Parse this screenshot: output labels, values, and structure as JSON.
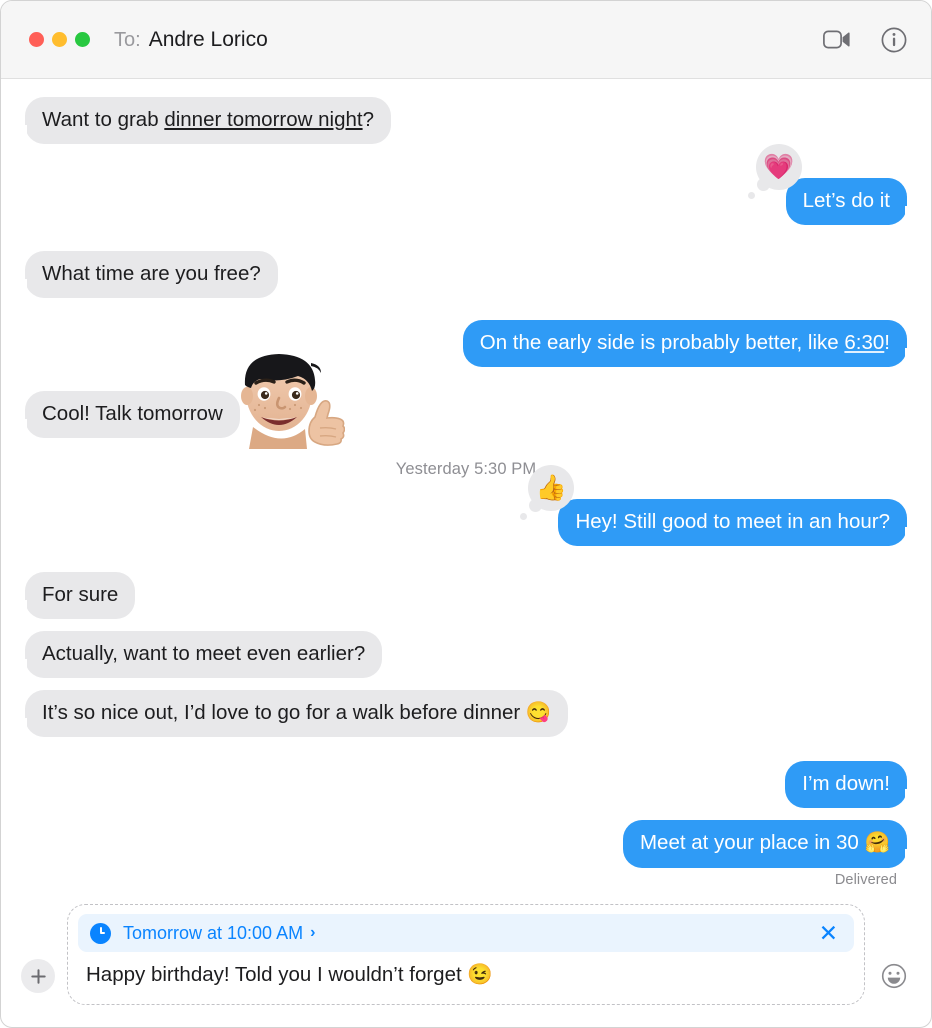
{
  "window": {
    "traffic_lights": [
      {
        "name": "close",
        "color": "#ff5f57"
      },
      {
        "name": "minimize",
        "color": "#ffbd2e"
      },
      {
        "name": "maximize",
        "color": "#28c840"
      }
    ]
  },
  "titlebar": {
    "to_label": "To:",
    "recipient": "Andre Lorico",
    "facetime_icon": "video-camera-icon",
    "info_icon": "info-circle-icon"
  },
  "colors": {
    "outgoing_bubble": "#2f9bf6",
    "incoming_bubble": "#e8e8ea",
    "accent_blue": "#0a84ff",
    "schedule_banner_bg": "#eaf4fe",
    "titlebar_bg": "#f6f6f6"
  },
  "conversation": {
    "messages": [
      {
        "id": "m1",
        "direction": "in",
        "text_before": "Want to grab ",
        "link": "dinner tomorrow night",
        "text_after": "?",
        "tapback": null
      },
      {
        "id": "m2",
        "direction": "out",
        "text_before": "Let’s do it",
        "link": "",
        "text_after": "",
        "tapback": "💗",
        "tapback_name": "heart-tapback"
      },
      {
        "id": "m3",
        "direction": "in",
        "text_before": "What time are you free?",
        "link": "",
        "text_after": "",
        "tapback": null
      },
      {
        "id": "m4",
        "direction": "out",
        "text_before": "On the early side is probably better, like ",
        "link": "6:30",
        "text_after": "!",
        "tapback": null
      },
      {
        "id": "m5",
        "direction": "in",
        "text_before": "Cool! Talk tomorrow",
        "link": "",
        "text_after": "",
        "tapback": null,
        "sticker": "memoji-thumbs-up-sticker"
      }
    ],
    "timestamp": "Yesterday 5:30 PM",
    "messages_after": [
      {
        "id": "m6",
        "direction": "out",
        "text_before": "Hey! Still good to meet in an hour?",
        "link": "",
        "text_after": "",
        "tapback": "👍",
        "tapback_name": "thumbs-up-tapback"
      },
      {
        "id": "m7",
        "direction": "in",
        "text_before": "For sure",
        "link": "",
        "text_after": "",
        "tapback": null
      },
      {
        "id": "m8",
        "direction": "in",
        "text_before": "Actually, want to meet even earlier?",
        "link": "",
        "text_after": "",
        "tapback": null
      },
      {
        "id": "m9",
        "direction": "in",
        "text_before": "It’s so nice out, I’d love to go for a walk before dinner 😋",
        "link": "",
        "text_after": "",
        "tapback": null
      },
      {
        "id": "m10",
        "direction": "out",
        "text_before": "I’m down!",
        "link": "",
        "text_after": "",
        "tapback": null
      },
      {
        "id": "m11",
        "direction": "out",
        "text_before": "Meet at your place in 30 🤗",
        "link": "",
        "text_after": "",
        "tapback": null
      }
    ],
    "delivered_label": "Delivered"
  },
  "composer": {
    "add_button_label": "+",
    "add_button_icon": "plus-icon",
    "emoji_button_icon": "smiley-face-icon",
    "schedule": {
      "icon": "clock-icon",
      "text": "Tomorrow at 10:00 AM",
      "chevron": "›",
      "close_label": "✕"
    },
    "input_value": "Happy birthday! Told you I wouldn’t forget 😉",
    "input_placeholder": "iMessage"
  }
}
